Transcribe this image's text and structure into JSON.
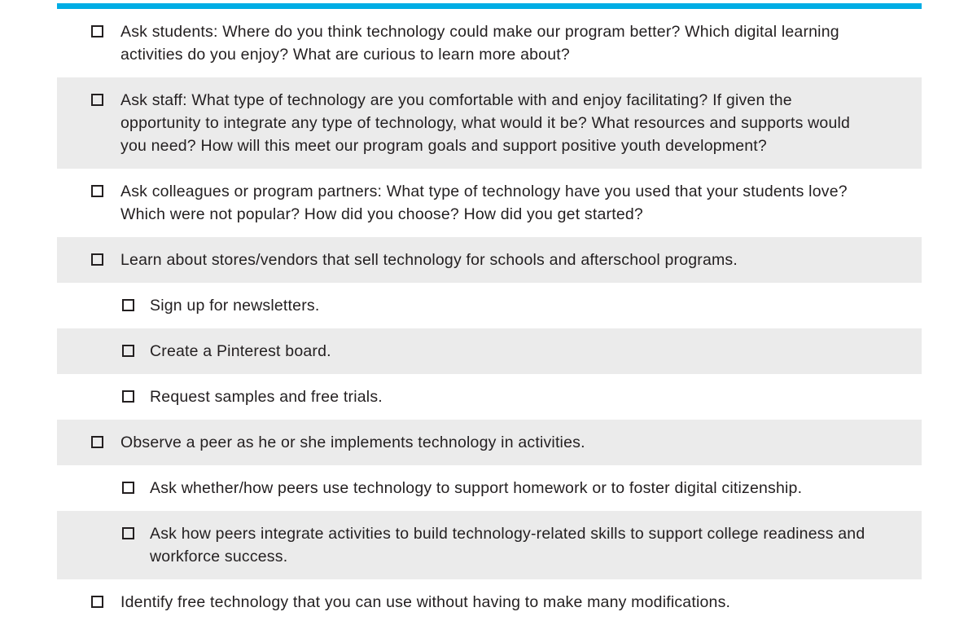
{
  "document": {
    "accent_color": "#00ade5",
    "shaded_row_color": "#ebebeb",
    "text_color": "#231f20",
    "checkbox_glyph": "empty-checkbox"
  },
  "checklist": {
    "items": [
      {
        "level": 1,
        "shaded": false,
        "text": "Ask students: Where do you think technology could make our program better? Which digital learning activities do you enjoy? What are curious to learn more about?"
      },
      {
        "level": 1,
        "shaded": true,
        "text": "Ask staff: What type of technology are you comfortable with and enjoy facilitating? If given the opportunity to integrate any type of technology, what would it be? What resources and supports would you need? How will this meet our program goals and support positive youth development?"
      },
      {
        "level": 1,
        "shaded": false,
        "text": "Ask colleagues or program partners: What type of technology have you used that your students love? Which were not popular? How did you choose? How did you get started?"
      },
      {
        "level": 1,
        "shaded": true,
        "text": "Learn about stores/vendors that sell technology for schools and afterschool programs."
      },
      {
        "level": 2,
        "shaded": false,
        "text": "Sign up for newsletters."
      },
      {
        "level": 2,
        "shaded": true,
        "text": "Create a Pinterest board."
      },
      {
        "level": 2,
        "shaded": false,
        "text": "Request samples and free trials."
      },
      {
        "level": 1,
        "shaded": true,
        "text": "Observe a peer as he or she implements technology in activities."
      },
      {
        "level": 2,
        "shaded": false,
        "text": "Ask whether/how peers use technology to support homework or to foster digital citizenship."
      },
      {
        "level": 2,
        "shaded": true,
        "text": "Ask how peers integrate activities to build technology-related skills to support college readiness and workforce success."
      },
      {
        "level": 1,
        "shaded": false,
        "text": "Identify free technology that you can use without having to make many modifications."
      }
    ]
  }
}
